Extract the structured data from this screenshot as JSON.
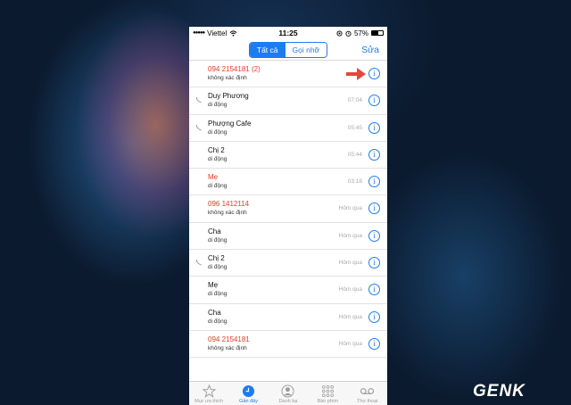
{
  "status": {
    "carrier": "Viettel",
    "time": "11:25",
    "battery": "57%",
    "battery_level": 0.57
  },
  "nav": {
    "seg_all": "Tất cả",
    "seg_missed": "Gọi nhỡ",
    "edit": "Sửa"
  },
  "calls": [
    {
      "name": "094 2154181 (2)",
      "type": "không xác định",
      "time": "",
      "missed": true,
      "outgoing": false,
      "highlighted": true
    },
    {
      "name": "Duy Phương",
      "type": "di động",
      "time": "07:04",
      "missed": false,
      "outgoing": true
    },
    {
      "name": "Phượng Cafe",
      "type": "di động",
      "time": "05:45",
      "missed": false,
      "outgoing": true
    },
    {
      "name": "Chị 2",
      "type": "di động",
      "time": "05:44",
      "missed": false,
      "outgoing": false
    },
    {
      "name": "Mẹ",
      "type": "di động",
      "time": "03:18",
      "missed": true,
      "outgoing": false
    },
    {
      "name": "096 1412114",
      "type": "không xác định",
      "time": "Hôm qua",
      "missed": true,
      "outgoing": false
    },
    {
      "name": "Cha",
      "type": "di động",
      "time": "Hôm qua",
      "missed": false,
      "outgoing": false
    },
    {
      "name": "Chị 2",
      "type": "di động",
      "time": "Hôm qua",
      "missed": false,
      "outgoing": true
    },
    {
      "name": "Mẹ",
      "type": "di động",
      "time": "Hôm qua",
      "missed": false,
      "outgoing": false
    },
    {
      "name": "Cha",
      "type": "di động",
      "time": "Hôm qua",
      "missed": false,
      "outgoing": false
    },
    {
      "name": "094 2154181",
      "type": "không xác định",
      "time": "Hôm qua",
      "missed": true,
      "outgoing": false
    }
  ],
  "tabs": [
    {
      "label": "Mục ưa thích",
      "icon": "star-icon",
      "active": false
    },
    {
      "label": "Gần đây",
      "icon": "clock-icon",
      "active": true
    },
    {
      "label": "Danh bạ",
      "icon": "contacts-icon",
      "active": false
    },
    {
      "label": "Bàn phím",
      "icon": "keypad-icon",
      "active": false
    },
    {
      "label": "Thư thoại",
      "icon": "voicemail-icon",
      "active": false
    }
  ],
  "colors": {
    "accent": "#1e7cf2",
    "missed": "#ea3c27",
    "arrow": "#e8453c"
  },
  "watermark": "GENK"
}
